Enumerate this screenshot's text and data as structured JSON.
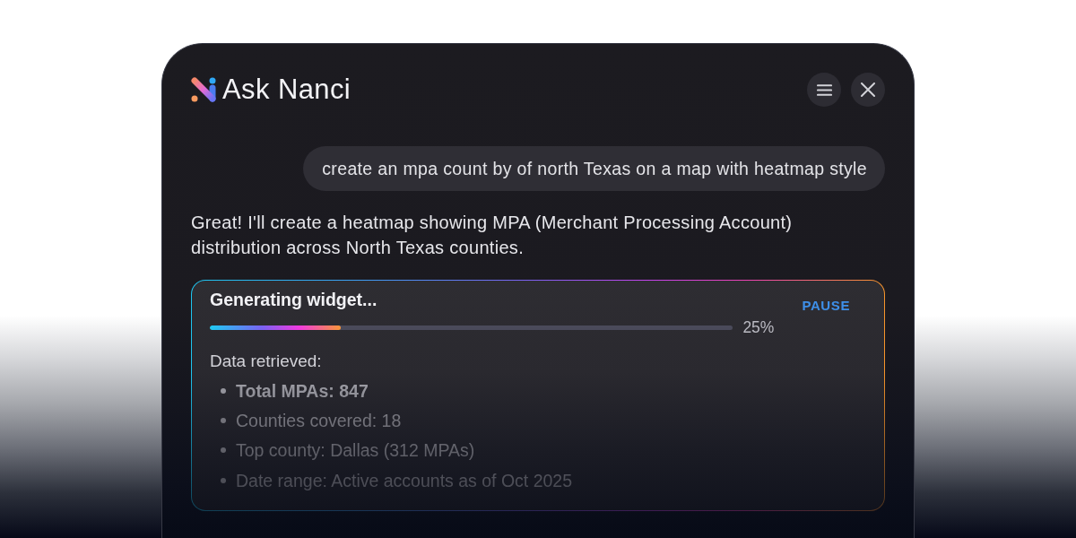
{
  "header": {
    "title": "Ask Nanci",
    "buttons": [
      {
        "kind": "menu"
      },
      {
        "kind": "close"
      }
    ]
  },
  "conversation": [
    {
      "kind": "user",
      "text": "create an mpa count by of north Texas on a map with heatmap style"
    },
    {
      "kind": "assistant",
      "text": "Great! I'll create a heatmap showing MPA (Merchant Processing Account) distribution across North Texas counties."
    }
  ],
  "widget": {
    "status": "Generating widget...",
    "action": "PAUSE",
    "progress": {
      "level": 0.25,
      "reading": "25%"
    },
    "heading": "Data retrieved:",
    "items": [
      {
        "text": "Total MPAs: 847",
        "bold": true
      },
      {
        "text": "Counties covered: 18",
        "bold": false
      },
      {
        "text": "Top county: Dallas (312 MPAs)",
        "bold": false
      },
      {
        "text": "Date range: Active accounts as of Oct 2025",
        "bold": false
      }
    ]
  }
}
